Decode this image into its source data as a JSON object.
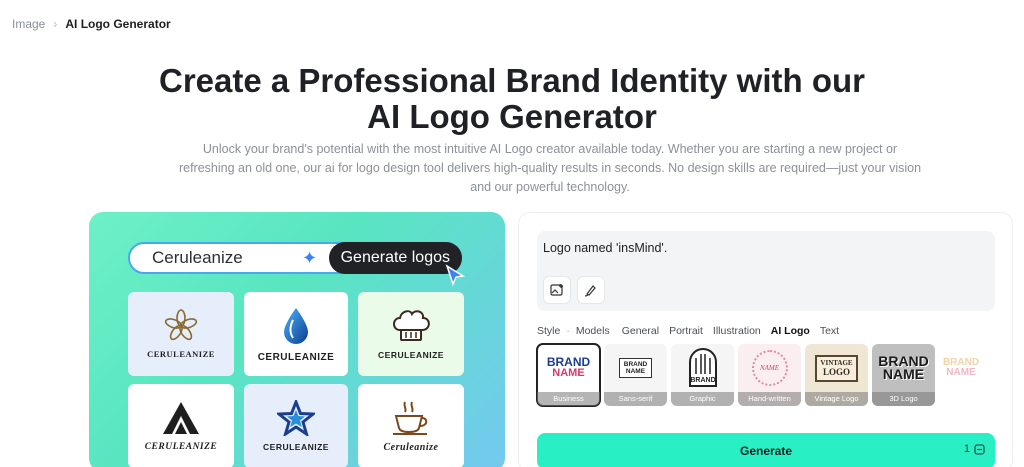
{
  "breadcrumb": {
    "parent": "Image",
    "separator": "›",
    "current": "AI Logo Generator"
  },
  "hero": {
    "title_line1": "Create a Professional Brand Identity with our",
    "title_line2": "AI Logo Generator",
    "description": "Unlock your brand's potential with the most intuitive AI Logo creator available today. Whether you are starting a new project or refreshing an old one, our ai for logo design tool delivers high-quality results in seconds. No design skills are required—just your vision and our powerful technology."
  },
  "showcase": {
    "input_text": "Ceruleanize",
    "button_label": "Generate logos",
    "logos": [
      {
        "caption": "CERULEANIZE",
        "icon": "flower-icon"
      },
      {
        "caption": "CERULEANIZE",
        "icon": "water-drop-icon"
      },
      {
        "caption": "CERULEANIZE",
        "icon": "chef-hat-icon"
      },
      {
        "caption": "CERULEANIZE",
        "icon": "mountain-a-icon"
      },
      {
        "caption": "CERULEANIZE",
        "icon": "star-icon"
      },
      {
        "caption": "Ceruleanize",
        "icon": "coffee-cup-icon"
      }
    ]
  },
  "panel": {
    "prompt": "Logo named 'insMind'.",
    "tabs": [
      "Style",
      "Models",
      "General",
      "Portrait",
      "Illustration",
      "AI Logo",
      "Text"
    ],
    "active_tab": "AI Logo",
    "styles": [
      {
        "label": "Business",
        "art": "BRAND NAME"
      },
      {
        "label": "Sans-serif",
        "art": "BRAND NAME"
      },
      {
        "label": "Graphic",
        "art": "BRAND"
      },
      {
        "label": "Hand-written",
        "art": "NAME"
      },
      {
        "label": "Vintage Logo",
        "art": "VINTAGE LOGO"
      },
      {
        "label": "3D Logo",
        "art": "BRAND NAME"
      },
      {
        "label": "",
        "art": "BRAND NAME"
      }
    ],
    "generate_label": "Generate",
    "credit_count": "1"
  },
  "colors": {
    "accent": "#28f0c4",
    "hero_gradient_start": "#6ef0c8",
    "hero_gradient_end": "#74c8f0"
  }
}
